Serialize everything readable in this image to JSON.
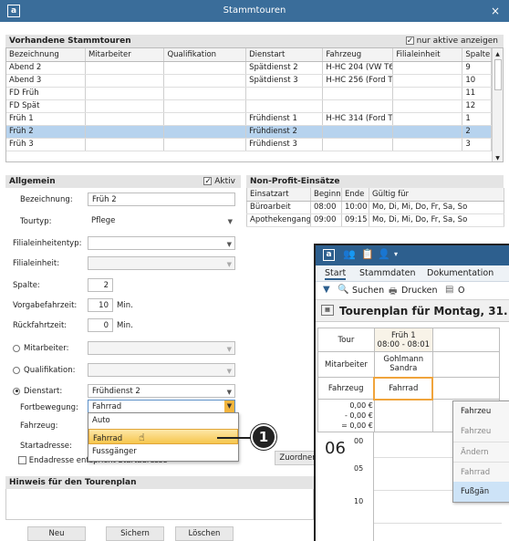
{
  "window": {
    "title": "Stammtouren",
    "app_icon": "a",
    "close": "×"
  },
  "tours": {
    "section": "Vorhandene Stammtouren",
    "only_active_label": "nur aktive anzeigen",
    "columns": [
      "Bezeichnung",
      "Mitarbeiter",
      "Qualifikation",
      "Dienstart",
      "Fahrzeug",
      "Filialeinheit",
      "Spalte"
    ],
    "rows": [
      [
        "Abend 2",
        "",
        "",
        "Spätdienst 2",
        "H-HC 204 (VW T6)",
        "",
        "9"
      ],
      [
        "Abend 3",
        "",
        "",
        "Spätdienst 3",
        "H-HC 256 (Ford Tra",
        "",
        "10"
      ],
      [
        "FD Früh",
        "",
        "",
        "",
        "",
        "",
        "11"
      ],
      [
        "FD Spät",
        "",
        "",
        "",
        "",
        "",
        "12"
      ],
      [
        "Früh 1",
        "",
        "",
        "Frühdienst 1",
        "H-HC 314 (Ford Tra",
        "",
        "1"
      ],
      [
        "Früh 2",
        "",
        "",
        "Frühdienst 2",
        "",
        "",
        "2"
      ],
      [
        "Früh 3",
        "",
        "",
        "Frühdienst 3",
        "",
        "",
        "3"
      ]
    ],
    "selected_index": 5
  },
  "general": {
    "section": "Allgemein",
    "active_label": "Aktiv",
    "bezeichnung_label": "Bezeichnung:",
    "bezeichnung": "Früh 2",
    "tourtyp_label": "Tourtyp:",
    "tourtyp": "Pflege",
    "filialtyp_label": "Filialeinheitentyp:",
    "filial_label": "Filialeinheit:",
    "spalte_label": "Spalte:",
    "spalte": "2",
    "vorgabe_label": "Vorgabefahrzeit:",
    "vorgabe": "10",
    "min1": "Min.",
    "rueck_label": "Rückfahrtzeit:",
    "rueck": "0",
    "min2": "Min.",
    "mitarbeiter_label": "Mitarbeiter:",
    "qualifikation_label": "Qualifikation:",
    "dienstart_label": "Dienstart:",
    "dienstart": "Frühdienst 2",
    "fortbewegung_label": "Fortbewegung:",
    "fortbewegung": "Fahrrad",
    "fahrzeug_label": "Fahrzeug:",
    "startadresse_label": "Startadresse:",
    "endadresse_label": "Endadresse entspricht Startadresse"
  },
  "dropdown": {
    "options": [
      "Auto",
      "Fahrrad",
      "Fussgänger"
    ],
    "highlight": 1
  },
  "nonprofit": {
    "section": "Non-Profit-Einsätze",
    "columns": [
      "Einsatzart",
      "Beginn",
      "Ende",
      "Gültig für"
    ],
    "rows": [
      [
        "Büroarbeit",
        "08:00",
        "10:00",
        "Mo, Di, Mi, Do, Fr, Sa, So"
      ],
      [
        "Apothekengang",
        "09:00",
        "09:15",
        "Mo, Di, Mi, Do, Fr, Sa, So"
      ]
    ],
    "assign_button": "Zuordnen"
  },
  "hint": {
    "section": "Hinweis für den Tourenplan"
  },
  "buttons": {
    "new": "Neu",
    "save": "Sichern",
    "delete": "Löschen"
  },
  "callout": "1",
  "inset": {
    "app_icon": "a",
    "tabs": [
      "Start",
      "Stammdaten",
      "Dokumentation"
    ],
    "search": "Suchen",
    "print": "Drucken",
    "extra": "O",
    "plan_title": "Tourenplan für Montag, 31.",
    "tour_label": "Tour",
    "tour_name": "Früh 1",
    "tour_time": "08:00 - 08:01",
    "mitarbeiter_label": "Mitarbeiter",
    "mitarbeiter_name": "Gohlmann Sandra",
    "fahrzeug_label": "Fahrzeug",
    "fahrzeug": "Fahrrad",
    "money": [
      "0,00 €",
      "0,00 €",
      "0,00 €"
    ],
    "money_prefix": [
      "",
      "-",
      "="
    ],
    "hour": "06",
    "minutes": [
      "00",
      "05",
      "10"
    ],
    "context": [
      "Fahrzeu",
      "Fahrzeu",
      "Ändern",
      "Fahrrad",
      "Fußgän"
    ]
  }
}
